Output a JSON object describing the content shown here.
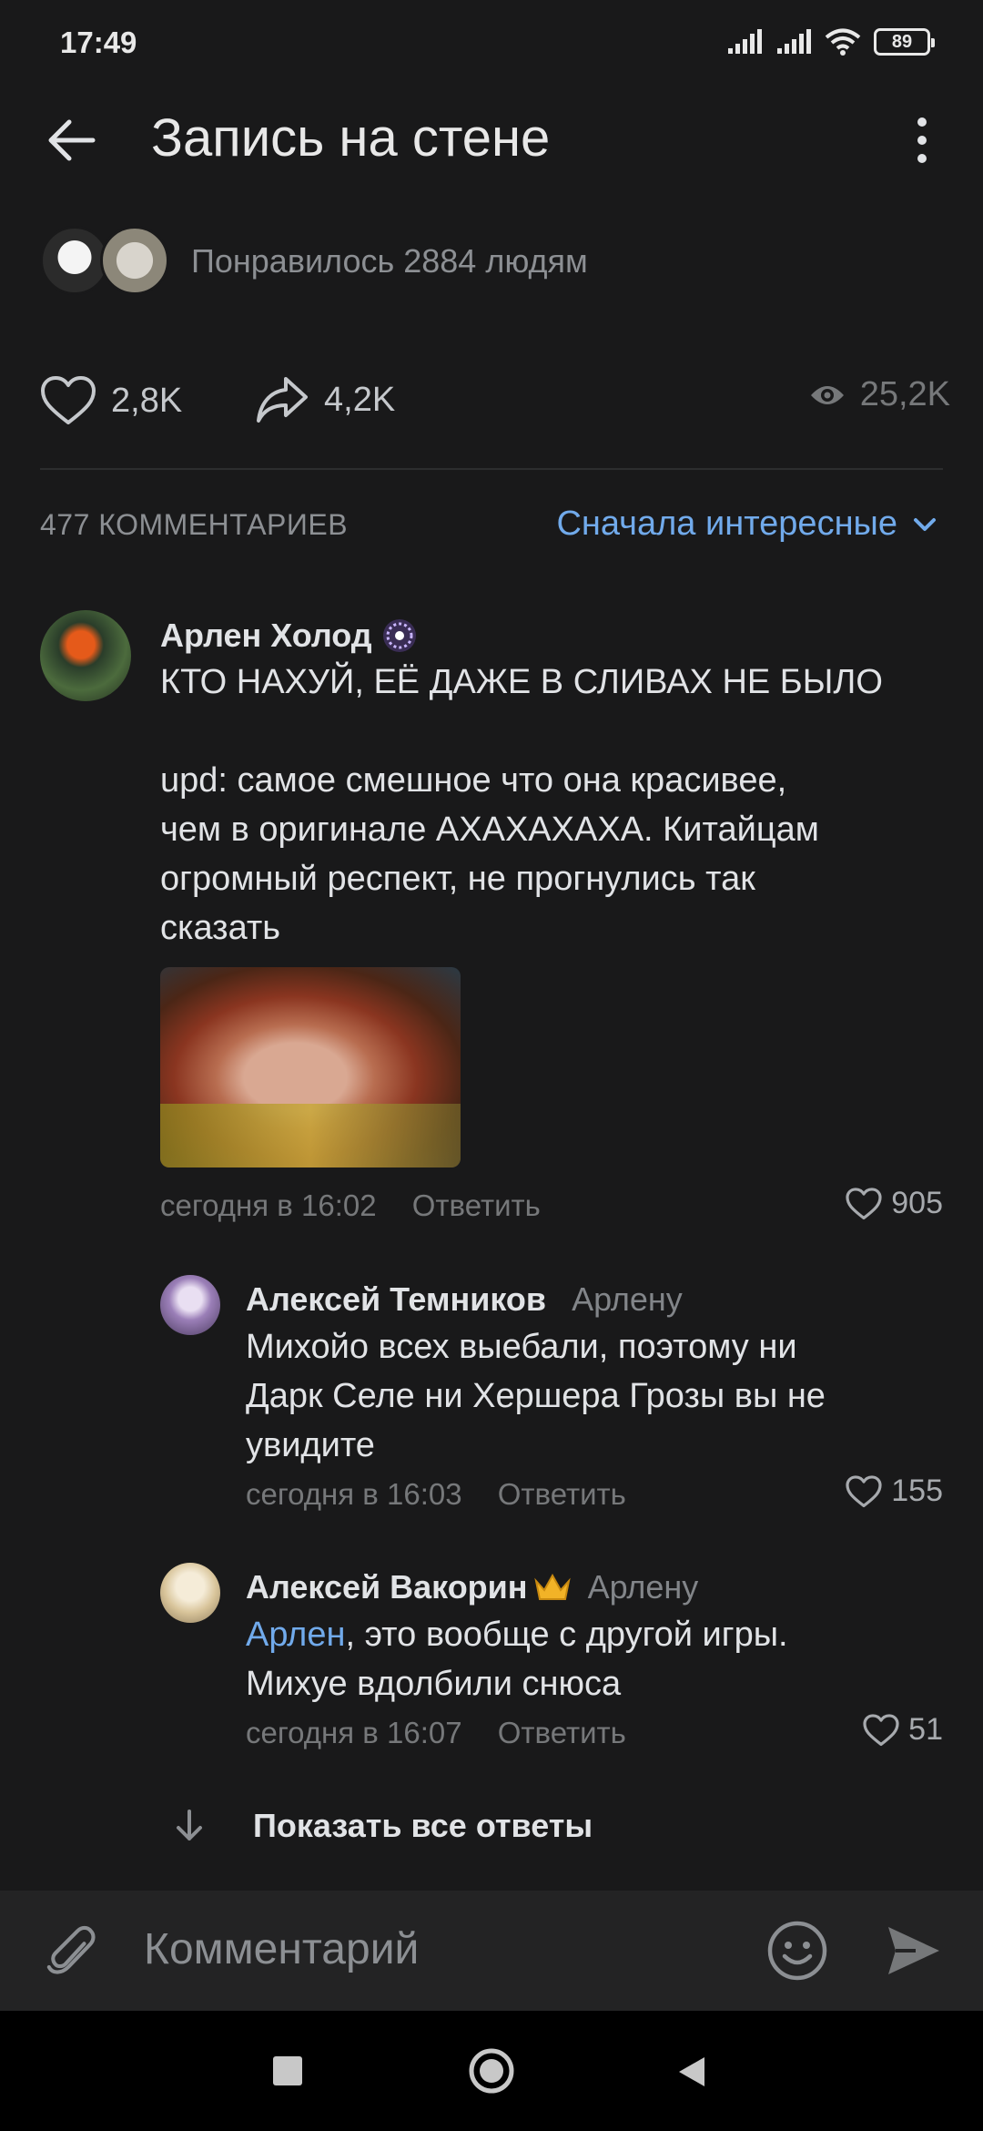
{
  "status": {
    "time": "17:49",
    "battery": "89"
  },
  "header": {
    "title": "Запись на стене"
  },
  "likes_line": {
    "text": "Понравилось 2884 людям"
  },
  "stats": {
    "likes": "2,8K",
    "shares": "4,2K",
    "views": "25,2K"
  },
  "comments": {
    "count_label": "477 КОММЕНТАРИЕВ",
    "sort_label": "Сначала интересные"
  },
  "comment1": {
    "author": "Арлен Холод",
    "line1": "КТО НАХУЙ, ЕЁ ДАЖЕ В СЛИВАХ НЕ БЫЛО",
    "line2": "upd: самое смешное что она красивее,",
    "line3": "чем в оригинале АХАХАХАХА. Китайцам",
    "line4": "огромный респект, не прогнулись так",
    "line5": "сказать",
    "time": "сегодня в 16:02",
    "reply": "Ответить",
    "likes": "905"
  },
  "reply1": {
    "author": "Алексей Темников",
    "to": "Арлену",
    "line1": "Михойо всех выебали, поэтому ни",
    "line2": "Дарк Селе ни Хершера Грозы вы не",
    "line3": "увидите",
    "time": "сегодня в 16:03",
    "reply": "Ответить",
    "likes": "155"
  },
  "reply2": {
    "author": "Алексей Вакорин",
    "to": "Арлену",
    "mention": "Арлен",
    "line1_rest": ", это вообще с другой игры.",
    "line2": "Михуе вдолбили снюса",
    "time": "сегодня в 16:07",
    "reply": "Ответить",
    "likes": "51"
  },
  "show_all": "Показать все ответы",
  "input": {
    "placeholder": "Комментарий"
  },
  "colors": {
    "accent": "#71aaeb",
    "background": "#19191a"
  }
}
